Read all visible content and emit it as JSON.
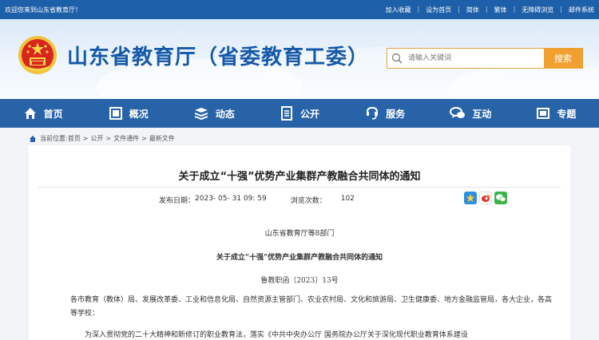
{
  "topbar": {
    "welcome": "欢迎您来到山东省教育厅！",
    "links": [
      "加入收藏",
      "设为首页",
      "简体",
      "繁体",
      "无障碍浏览",
      "邮件系统"
    ]
  },
  "header": {
    "title": "山东省教育厅（省委教育工委）",
    "search_placeholder": "请输入关键词",
    "search_button": "搜索"
  },
  "nav": [
    {
      "label": "首页",
      "icon": "home-icon"
    },
    {
      "label": "概况",
      "icon": "overview-icon"
    },
    {
      "label": "动态",
      "icon": "news-icon"
    },
    {
      "label": "公开",
      "icon": "document-icon"
    },
    {
      "label": "服务",
      "icon": "service-icon"
    },
    {
      "label": "互动",
      "icon": "chat-icon"
    },
    {
      "label": "专题",
      "icon": "topic-icon"
    }
  ],
  "breadcrumb": {
    "prefix": "当前位置:",
    "items": [
      "首页",
      "公开",
      "文件通件",
      "最新文件"
    ]
  },
  "article": {
    "title": "关于成立“十强”优势产业集群产教融合共同体的通知",
    "date_label": "发布日期：",
    "date": "2023- 05- 31 09: 59",
    "views_label": "浏览次数：",
    "views": "102",
    "dept": "山东省教育厅等8部门",
    "subtitle": "关于成立“十强”优势产业集群产教融合共同体的通知",
    "doc_no": "鲁教职函〔2023〕13号",
    "para1": "各市教育（教体）局、发展改革委、工业和信息化局、自然资源主管部门、农业农村局、文化和旅游局、卫生健康委、地方金融监管局，各大企业，各高等学校：",
    "para2": "为深入贯彻党的二十大精神和新修订的职业教育法，落实《中共中央办公厅  国务院办公厅关于深化现代职业教育体系建设"
  },
  "share": [
    "weibo-icon",
    "qq-zone-icon",
    "wechat-icon"
  ],
  "colors": {
    "nav": "#2863a8",
    "topbar": "#1d5fa8",
    "accent": "#f0a030",
    "title": "#1559a8"
  }
}
